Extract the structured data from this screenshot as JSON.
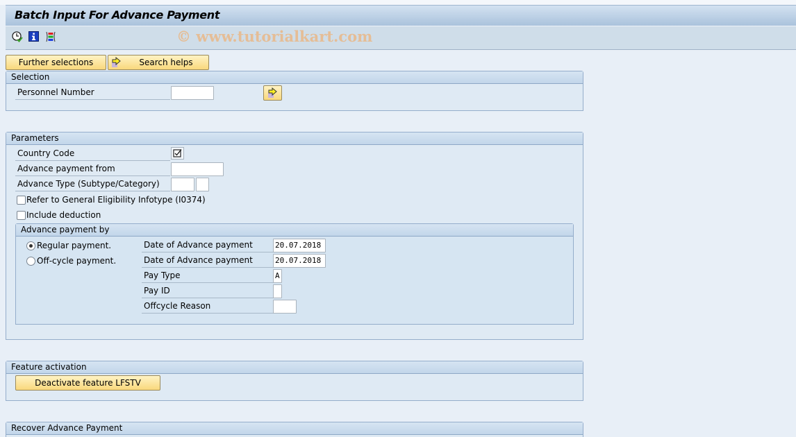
{
  "window": {
    "title": "Batch Input For Advance Payment",
    "watermark": "© www.tutorialkart.com"
  },
  "toolbar": {
    "icons": [
      {
        "name": "execute-clock-icon",
        "label": "Execute"
      },
      {
        "name": "info-icon",
        "label": "Program documentation"
      },
      {
        "name": "selection-variables-icon",
        "label": "Selection options"
      }
    ]
  },
  "buttons": {
    "further_selections": "Further selections",
    "search_helps": "Search helps"
  },
  "selection": {
    "title": "Selection",
    "personnel_number": {
      "label": "Personnel Number",
      "value": ""
    }
  },
  "parameters": {
    "title": "Parameters",
    "country_code": {
      "label": "Country Code",
      "checked": true
    },
    "advance_payment_from": {
      "label": "Advance payment from",
      "value": ""
    },
    "advance_type": {
      "label": "Advance Type (Subtype/Category)",
      "subtype": "",
      "category": ""
    },
    "refer_eligibility": {
      "label": "Refer to General Eligibility Infotype (I0374)",
      "checked": false
    },
    "include_deduction": {
      "label": "Include deduction",
      "checked": false
    },
    "advance_payment_by": {
      "title": "Advance payment by",
      "regular": {
        "label": "Regular payment.",
        "selected": true
      },
      "offcycle": {
        "label": "Off-cycle payment.",
        "selected": false
      },
      "regular_date": {
        "label": "Date of Advance payment",
        "value": "20.07.2018"
      },
      "offcycle_date": {
        "label": "Date of Advance payment",
        "value": "20.07.2018"
      },
      "pay_type": {
        "label": "Pay Type",
        "value": "A"
      },
      "pay_id": {
        "label": "Pay ID",
        "value": ""
      },
      "offcycle_reason": {
        "label": "Offcycle Reason",
        "value": ""
      }
    }
  },
  "feature_activation": {
    "title": "Feature activation",
    "button": "Deactivate feature LFSTV"
  },
  "recover": {
    "title": "Recover Advance Payment"
  }
}
